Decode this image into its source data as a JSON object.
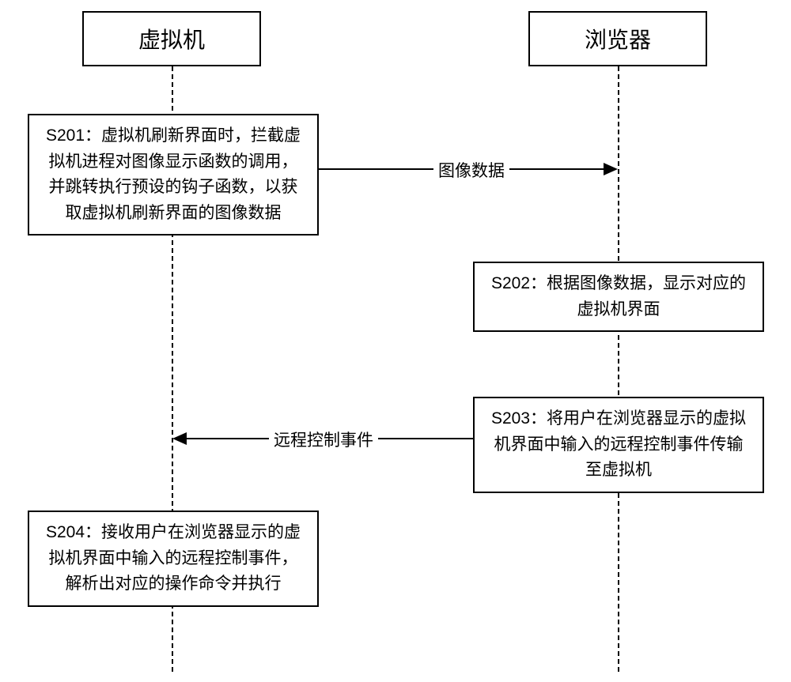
{
  "participants": {
    "vm": "虚拟机",
    "browser": "浏览器"
  },
  "steps": {
    "s201": "S201：虚拟机刷新界面时，拦截虚拟机进程对图像显示函数的调用，并跳转执行预设的钩子函数，以获取虚拟机刷新界面的图像数据",
    "s202": "S202：根据图像数据，显示对应的虚拟机界面",
    "s203": "S203：将用户在浏览器显示的虚拟机界面中输入的远程控制事件传输至虚拟机",
    "s204": "S204：接收用户在浏览器显示的虚拟机界面中输入的远程控制事件，解析出对应的操作命令并执行"
  },
  "messages": {
    "image_data": "图像数据",
    "remote_control_event": "远程控制事件"
  }
}
